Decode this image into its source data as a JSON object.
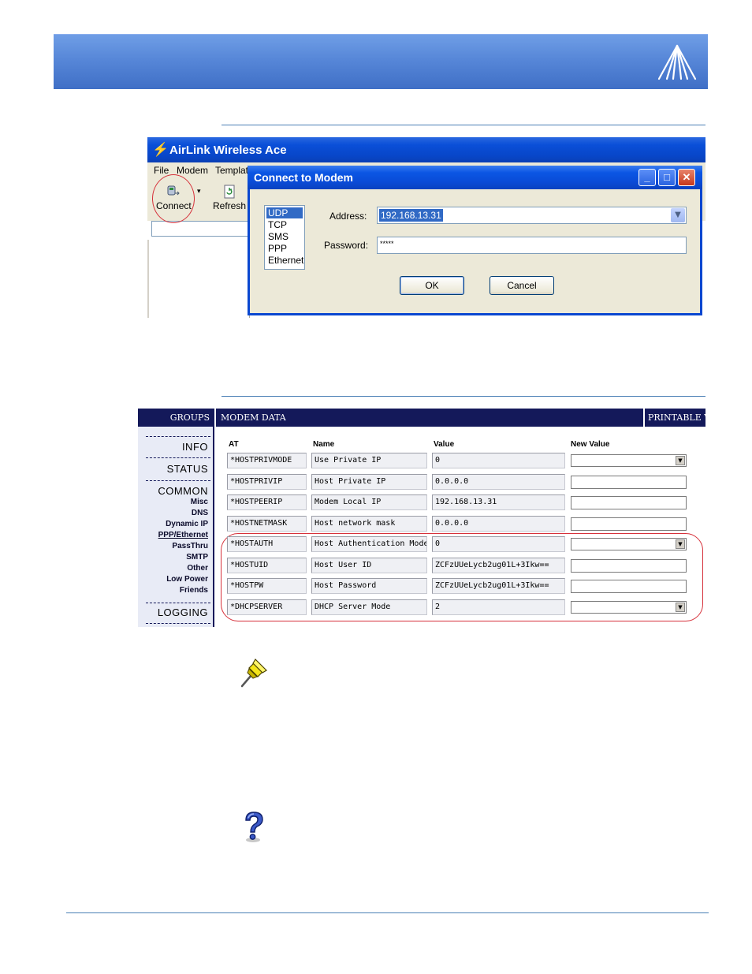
{
  "ace_window": {
    "title": "AirLink Wireless Ace",
    "menu": [
      "File",
      "Modem",
      "Templat"
    ],
    "toolbar": {
      "connect_label": "Connect",
      "refresh_label": "Refresh"
    }
  },
  "connect_dialog": {
    "title": "Connect to Modem",
    "protocols": [
      "UDP",
      "TCP",
      "SMS",
      "PPP",
      "Ethernet"
    ],
    "selected_protocol": "UDP",
    "address_label": "Address:",
    "address_value": "192.168.13.31",
    "password_label": "Password:",
    "password_value": "*****",
    "ok_label": "OK",
    "cancel_label": "Cancel"
  },
  "modem_data": {
    "groups_header": "GROUPS",
    "data_header": "MODEM DATA",
    "printable_header": "PRINTABLE V",
    "groups": {
      "info": "INFO",
      "status": "STATUS",
      "common": "COMMON",
      "common_items": [
        "Misc",
        "DNS",
        "Dynamic IP",
        "PPP/Ethernet",
        "PassThru",
        "SMTP",
        "Other",
        "Low Power",
        "Friends"
      ],
      "active_item": "PPP/Ethernet",
      "logging": "LOGGING"
    },
    "columns": {
      "at": "AT",
      "name": "Name",
      "value": "Value",
      "new_value": "New Value"
    },
    "rows": [
      {
        "at": "*HOSTPRIVMODE",
        "name": "Use Private IP",
        "value": "0",
        "input": "select"
      },
      {
        "at": "*HOSTPRIVIP",
        "name": "Host Private IP",
        "value": "0.0.0.0",
        "input": "text"
      },
      {
        "at": "*HOSTPEERIP",
        "name": "Modem Local IP",
        "value": "192.168.13.31",
        "input": "text"
      },
      {
        "at": "*HOSTNETMASK",
        "name": "Host network mask",
        "value": "0.0.0.0",
        "input": "text"
      },
      {
        "at": "*HOSTAUTH",
        "name": "Host Authentication Mode",
        "value": "0",
        "input": "select"
      },
      {
        "at": "*HOSTUID",
        "name": "Host User ID",
        "value": "ZCFzUUeLycb2ug01L+3Ikw==",
        "input": "text"
      },
      {
        "at": "*HOSTPW",
        "name": "Host Password",
        "value": "ZCFzUUeLycb2ug01L+3Ikw==",
        "input": "text"
      },
      {
        "at": "*DHCPSERVER",
        "name": "DHCP Server Mode",
        "value": "2",
        "input": "select"
      }
    ]
  },
  "colors": {
    "banner": "#5787d8",
    "xp_title": "#0a4fd8",
    "groups_header_bg": "#14195a",
    "highlight_circle": "#d6303a",
    "rule": "#4a7fb5"
  },
  "icons": {
    "banner_logo": "airlink-logo-icon",
    "note": "pushpin-icon",
    "help": "question-icon"
  }
}
